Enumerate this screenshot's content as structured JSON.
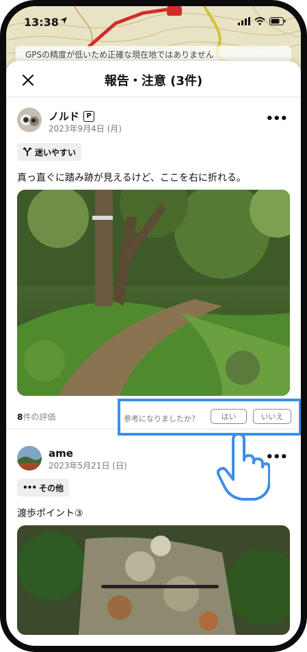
{
  "status_bar": {
    "time": "13:38"
  },
  "banner": {
    "text": "GPSの精度が低いため正確な現在地ではありません"
  },
  "sheet": {
    "title": "報告・注意 (3件)"
  },
  "posts": [
    {
      "username": "ノルド",
      "badge": "P",
      "date": "2023年9月4日 (月)",
      "tag": "迷いやすい",
      "tag_icon": "fork-path-icon",
      "text": "真っ直ぐに踏み跡が見えるけど、ここを右に折れる。",
      "rating_count": "8",
      "rating_suffix": "件の評価"
    },
    {
      "username": "ame",
      "date": "2023年5月21日 (日)",
      "tag": "その他",
      "tag_icon": "more-dots-icon",
      "text": "渡歩ポイント③"
    }
  ],
  "feedback": {
    "question": "参考になりましたか？",
    "yes_label": "はい",
    "no_label": "いいえ"
  },
  "colors": {
    "highlight": "#3d8fe6",
    "hand": "#3d8fe6"
  }
}
